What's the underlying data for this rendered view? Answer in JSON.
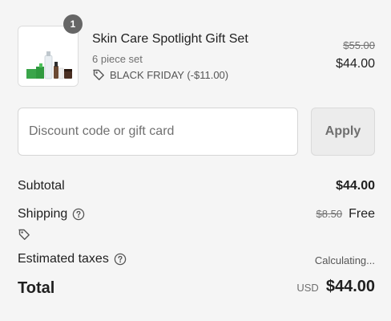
{
  "product": {
    "quantity": "1",
    "name": "Skin Care Spotlight Gift Set",
    "variant": "6 piece set",
    "discount_label": "BLACK FRIDAY (-$11.00)",
    "compare_price": "$55.00",
    "price": "$44.00",
    "image_icon": "product-photo"
  },
  "discount": {
    "placeholder": "Discount code or gift card",
    "value": "",
    "apply_label": "Apply"
  },
  "summary": {
    "subtotal_label": "Subtotal",
    "subtotal_value": "$44.00",
    "shipping_label": "Shipping",
    "shipping_compare": "$8.50",
    "shipping_value": "Free",
    "taxes_label": "Estimated taxes",
    "taxes_value": "Calculating...",
    "total_label": "Total",
    "total_currency": "USD",
    "total_value": "$44.00"
  },
  "icons": {
    "help": "question-circle-icon",
    "tag": "tag-icon"
  },
  "colors": {
    "background": "#f5f5f5",
    "badge": "#666666",
    "text": "#1f1f1f",
    "muted": "#707070"
  }
}
